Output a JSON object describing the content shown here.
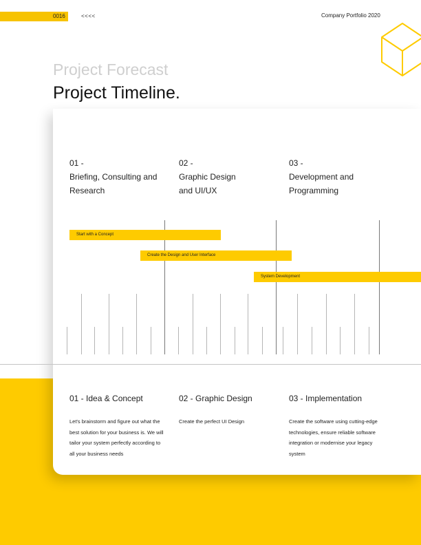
{
  "header": {
    "page_number": "0016",
    "prev_arrows": "<<<<",
    "title": "Company Portfolio 2020"
  },
  "subtitle": "Project Forecast",
  "title": "Project Timeline.",
  "colors": {
    "accent": "#fecb00",
    "text": "#222222",
    "subtitle": "#cfcfcf"
  },
  "icons": {
    "decor": "cube-outline-icon"
  },
  "phases": [
    {
      "num": "01 -",
      "name": "Briefing, Consulting and\nResearch"
    },
    {
      "num": "02 -",
      "name": "Graphic Design\nand UI/UX"
    },
    {
      "num": "03 -",
      "name": "Development and\nProgramming"
    }
  ],
  "gantt": [
    {
      "label": "Start with a Concept"
    },
    {
      "label": "Create the Design and User Interface"
    },
    {
      "label": "System Development"
    }
  ],
  "steps": [
    {
      "title": "01 - Idea & Concept",
      "desc": "Let's brainstorm and figure out what the best solution for your business is. We will tailor your system perfectly according to all your business needs"
    },
    {
      "title": "02 - Graphic Design",
      "desc": "Create the perfect UI Design"
    },
    {
      "title": "03 - Implementation",
      "desc": "Create the software using cutting-edge technologies, ensure reliable software integration or modernise your legacy system"
    }
  ]
}
